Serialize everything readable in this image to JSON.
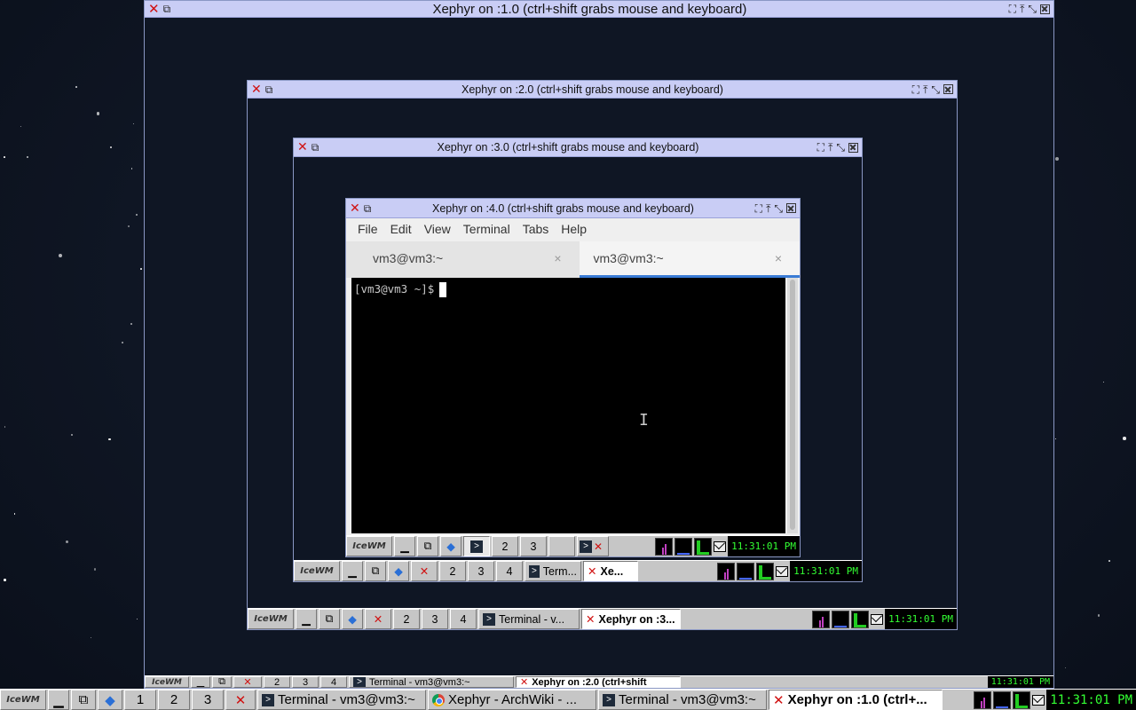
{
  "windows": {
    "w1": {
      "title": "Xephyr on :1.0 (ctrl+shift grabs mouse and keyboard)"
    },
    "w2": {
      "title": "Xephyr on :2.0 (ctrl+shift grabs mouse and keyboard)"
    },
    "w3": {
      "title": "Xephyr on :3.0 (ctrl+shift grabs mouse and keyboard)"
    },
    "w4": {
      "title": "Xephyr on :4.0 (ctrl+shift grabs mouse and keyboard)"
    }
  },
  "terminal": {
    "menu": [
      "File",
      "Edit",
      "View",
      "Terminal",
      "Tabs",
      "Help"
    ],
    "tabs": [
      {
        "label": "vm3@vm3:~",
        "close": "×"
      },
      {
        "label": "vm3@vm3:~",
        "close": "×"
      }
    ],
    "prompt": "[vm3@vm3 ~]$"
  },
  "taskbars": {
    "main": {
      "logo": "IceWM",
      "workspaces": [
        "1",
        "2",
        "3"
      ],
      "tasks": [
        "Terminal - vm3@vm3:~",
        "Xephyr - ArchWiki - ...",
        "Terminal - vm3@vm3:~",
        "Xephyr on :1.0 (ctrl+..."
      ],
      "clock": "11:31:01 PM"
    },
    "w1": {
      "logo": "IceWM",
      "workspaces": [
        "2",
        "3",
        "4"
      ],
      "tasks": [
        "Terminal - vm3@vm3:~",
        "Xephyr on :2.0 (ctrl+shift"
      ],
      "clock": "11:31:01 PM"
    },
    "w2": {
      "logo": "IceWM",
      "workspaces": [
        "2",
        "3",
        "4"
      ],
      "tasks": [
        "Terminal - v...",
        "Xephyr on :3..."
      ],
      "clock": "11:31:01 PM"
    },
    "w3": {
      "logo": "IceWM",
      "workspaces": [
        "2",
        "3",
        "4"
      ],
      "tasks": [
        "Term...",
        "Xe..."
      ],
      "clock": "11:31:01 PM"
    },
    "w4": {
      "logo": "IceWM",
      "workspaces": [
        "2",
        "3"
      ],
      "clock": "11:31:01 PM"
    }
  },
  "colors": {
    "titlebar": "#c9cdf5",
    "taskbar": "#c6c6c6",
    "clock_text": "#33ff33",
    "tab_accent": "#3a7bd5"
  }
}
